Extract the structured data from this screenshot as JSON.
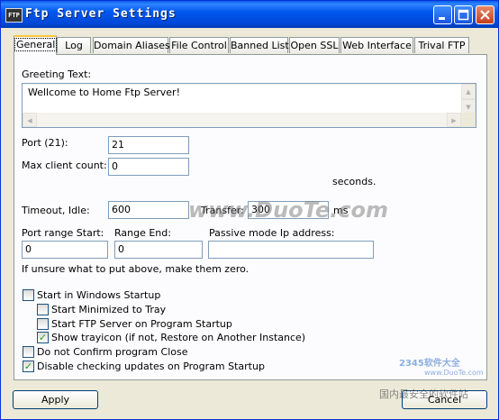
{
  "window": {
    "title": "Ftp Server Settings",
    "app_icon_label": "FTP"
  },
  "tabs": [
    {
      "label": "General",
      "active": true
    },
    {
      "label": "Log"
    },
    {
      "label": "Domain Aliases"
    },
    {
      "label": "File Control"
    },
    {
      "label": "Banned List"
    },
    {
      "label": "Open SSL"
    },
    {
      "label": "Web Interface"
    },
    {
      "label": "Trival FTP"
    }
  ],
  "general": {
    "greeting_label": "Greeting Text:",
    "greeting_value": "Wellcome to Home Ftp Server!",
    "port_label": "Port (21):",
    "port_value": "21",
    "max_client_label": "Max client count:",
    "max_client_value": "0",
    "seconds_label": "seconds.",
    "timeout_label": "Timeout, Idle:",
    "timeout_idle_value": "600",
    "transfer_label": "Transfer:",
    "transfer_value": "300",
    "ms_label": "ms",
    "port_range_start_label": "Port range Start:",
    "port_range_start_value": "0",
    "range_end_label": "Range End:",
    "range_end_value": "0",
    "passive_ip_label": "Passive mode Ip address:",
    "passive_ip_value": "",
    "hint": "If unsure what to put above, make them zero.",
    "checkboxes": [
      {
        "label": "Start in Windows Startup",
        "checked": false
      },
      {
        "label": "Start Minimized to Tray",
        "checked": false
      },
      {
        "label": "Start FTP Server on Program Startup",
        "checked": false
      },
      {
        "label": "Show trayicon (if not, Restore on Another Instance)",
        "checked": true
      },
      {
        "label": "Do not Confirm program Close",
        "checked": false
      },
      {
        "label": "Disable checking updates on Program Startup",
        "checked": true
      }
    ]
  },
  "buttons": {
    "apply": "Apply",
    "cancel": "Cancel"
  },
  "watermarks": {
    "center": "www.DuoTe.com",
    "brand": "2345软件大全",
    "url": "www.DuoTe.com",
    "footer": "国内最安全的软件站"
  },
  "colors": {
    "titlebar": "#0054e3",
    "window_bg": "#ece9d8",
    "tab_active_accent": "#ffc83c",
    "check_mark": "#21a121"
  },
  "icons": [
    "ftp-app-icon",
    "minimize-icon",
    "maximize-icon",
    "close-icon",
    "checkmark-icon",
    "scroll-arrow-icon"
  ]
}
